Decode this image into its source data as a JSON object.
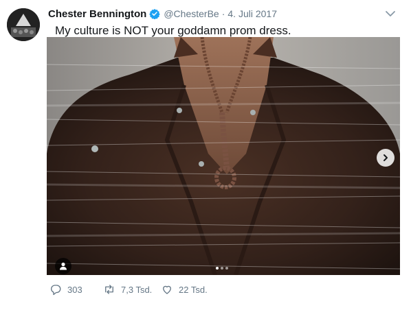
{
  "tweet": {
    "author_name": "Chester Bennington",
    "handle": "@ChesterBe",
    "separator": "·",
    "date": "4. Juli 2017",
    "text": "My culture is NOT your goddamn prom dress.",
    "reply_count": "303",
    "retweet_count": "7,3 Tsd.",
    "like_count": "22 Tsd.",
    "media_page_count": 3,
    "media_active_index": 0
  },
  "colors": {
    "verified": "#1da1f2",
    "secondary_text": "#657786",
    "primary_text": "#14171a"
  },
  "icons": [
    "verified-badge-icon",
    "chevron-down-icon",
    "next-arrow-icon",
    "user-tag-icon",
    "reply-icon",
    "retweet-icon",
    "like-icon"
  ]
}
